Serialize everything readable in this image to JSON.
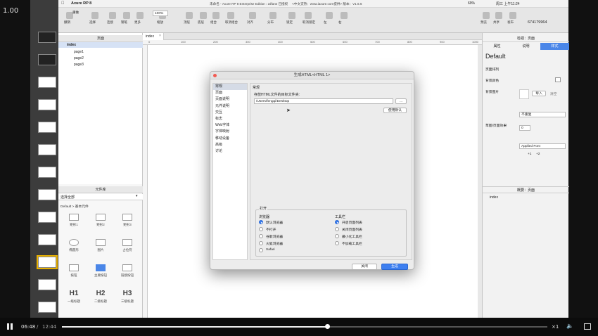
{
  "player": {
    "speed": "1.00",
    "time_current": "06:48",
    "time_sep": "/",
    "time_total": "12:44",
    "rate": "×1",
    "progress": 0.546
  },
  "menubar": {
    "app": "Axure RP 8",
    "title": "未命名 - Axure RP 8 Enterprise Edition : zdfans 已授权　 <中文支持：www.iaxure.com提供> 版本：V1.6.6",
    "clock": "周三 上午11:24",
    "battery": "69%"
  },
  "toolbar": {
    "undo": "撤销",
    "redo": "重做",
    "select": "选择",
    "connect": "连接",
    "pen": "钢笔",
    "more": "更多",
    "zoom": "100%",
    "zoom_label": "缩放",
    "top": "顶层",
    "bottom": "底层",
    "group": "组合",
    "ungroup": "取消组合",
    "align": "对齐",
    "distribute": "分布",
    "lock": "锁定",
    "unlock": "取消锁定",
    "left": "左",
    "right": "右",
    "preview": "预览",
    "share": "共享",
    "publish": "发布",
    "user": "674179964"
  },
  "pages_panel": {
    "title": "页面",
    "root": "index",
    "items": [
      "page1",
      "page2",
      "page3"
    ]
  },
  "library": {
    "title": "元件库",
    "select": "选择全部",
    "group": "Default > 基本元件",
    "widgets": [
      {
        "l": "矩形1"
      },
      {
        "l": "矩形2"
      },
      {
        "l": "矩形3"
      },
      {
        "l": "椭圆形"
      },
      {
        "l": "图片"
      },
      {
        "l": "占位符"
      },
      {
        "l": "按钮"
      },
      {
        "l": "主要按钮"
      },
      {
        "l": "链接按钮"
      },
      {
        "l": "一级标题"
      },
      {
        "l": "二级标题"
      },
      {
        "l": "三级标题"
      }
    ],
    "headings": [
      "H1",
      "H2",
      "H3"
    ]
  },
  "canvas": {
    "tab": "index",
    "ticks": [
      "0",
      "100",
      "200",
      "300",
      "400",
      "500",
      "600",
      "700",
      "800",
      "900",
      "1000"
    ]
  },
  "right_panel": {
    "tab_props": "属性",
    "tab_notes": "说明",
    "tab_style": "样式",
    "panel_title": "检视：页面",
    "style_name": "Default",
    "align": "页面排列",
    "bgcolor": "背景颜色",
    "bgimage": "背景图片",
    "import": "导入",
    "clear": "清空",
    "repeat": "不重复",
    "sketch": "草图/页面效果",
    "sketch_val": "0",
    "font": "Applied Font",
    "plus": "+1",
    "plus2": "+2",
    "outline_title": "概要：页面",
    "outline_item": "index"
  },
  "dialog": {
    "title": "生成HTML<HTML 1>",
    "nav": [
      "常规",
      "页面",
      "页面说明",
      "元件说明",
      "交互",
      "标志",
      "Web字体",
      "字体映射",
      "移动设备",
      "高级",
      "讨论"
    ],
    "section": "常规",
    "folder_label": "存放HTML文件的目标文件夹:",
    "folder_value": "/Users/fengqi/Desktop",
    "browse": "...",
    "use_default": "使用默认",
    "open_title": "打开",
    "browser_title": "浏览器",
    "browsers": [
      "默认浏览器",
      "不打开",
      "谷歌浏览器",
      "火狐浏览器",
      "Safari"
    ],
    "toolbar_title": "工具栏",
    "toolbars": [
      "开启页面列表",
      "关闭页面列表",
      "最小化工具栏",
      "不加载工具栏"
    ],
    "close": "关闭",
    "generate": "生成"
  }
}
